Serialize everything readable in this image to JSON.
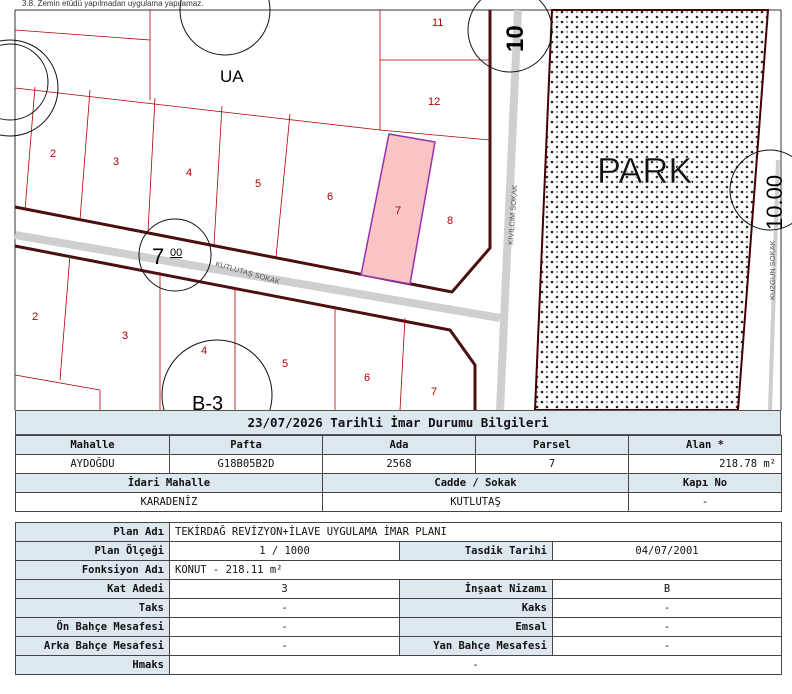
{
  "map": {
    "top_note": "3.8. Zemin etüdü yapılmadan uygulama yapılamaz.",
    "labels": {
      "ua": "UA",
      "park": "PARK",
      "street_kutlutas": "KUTLUTAŞ SOKAK",
      "street_kivilcim": "KIVILCIM SOKAK",
      "street_kuzgun": "KUZGUN SOKAK",
      "road_width_main": "7",
      "road_width_main_sup": "00",
      "road_width_vertical": "10",
      "road_width_right": "10.00",
      "block_b3": "B-3"
    },
    "parcels_upper": [
      "11",
      "12",
      "2",
      "3",
      "4",
      "5",
      "6",
      "7",
      "8"
    ],
    "parcels_lower": [
      "2",
      "3",
      "4",
      "5",
      "6",
      "7"
    ],
    "colors": {
      "highlight_fill": "#f9c4c4",
      "highlight_border": "#9a2fb0",
      "parcel_line": "#b00000"
    }
  },
  "title": "23/07/2026 Tarihli İmar Durumu Bilgileri",
  "summary": {
    "headers": [
      "Mahalle",
      "Pafta",
      "Ada",
      "Parsel",
      "Alan *"
    ],
    "values": [
      "AYDOĞDU",
      "G18B05B2D",
      "2568",
      "7",
      "218.78 m²"
    ],
    "headers2": [
      "İdari Mahalle",
      "Cadde / Sokak",
      "Kapı No"
    ],
    "values2": [
      "KARADENİZ",
      "KUTLUTAŞ",
      "-"
    ]
  },
  "plan": {
    "plan_adi_label": "Plan Adı",
    "plan_adi": "TEKİRDAĞ REVİZYON+İLAVE UYGULAMA İMAR PLANI",
    "plan_olcegi_label": "Plan Ölçeği",
    "plan_olcegi": "1 / 1000",
    "tasdik_label": "Tasdik Tarihi",
    "tasdik": "04/07/2001",
    "fonksiyon_label": "Fonksiyon Adı",
    "fonksiyon": "KONUT - 218.11 m²",
    "kat_label": "Kat Adedi",
    "kat": "3",
    "insaat_label": "İnşaat Nizamı",
    "insaat": "B",
    "taks_label": "Taks",
    "taks": "-",
    "kaks_label": "Kaks",
    "kaks": "-",
    "on_label": "Ön Bahçe Mesafesi",
    "on": "-",
    "emsal_label": "Emsal",
    "emsal": "-",
    "arka_label": "Arka Bahçe Mesafesi",
    "arka": "-",
    "yan_label": "Yan Bahçe Mesafesi",
    "yan": "-",
    "hmaks_label": "Hmaks",
    "hmaks": "-"
  }
}
